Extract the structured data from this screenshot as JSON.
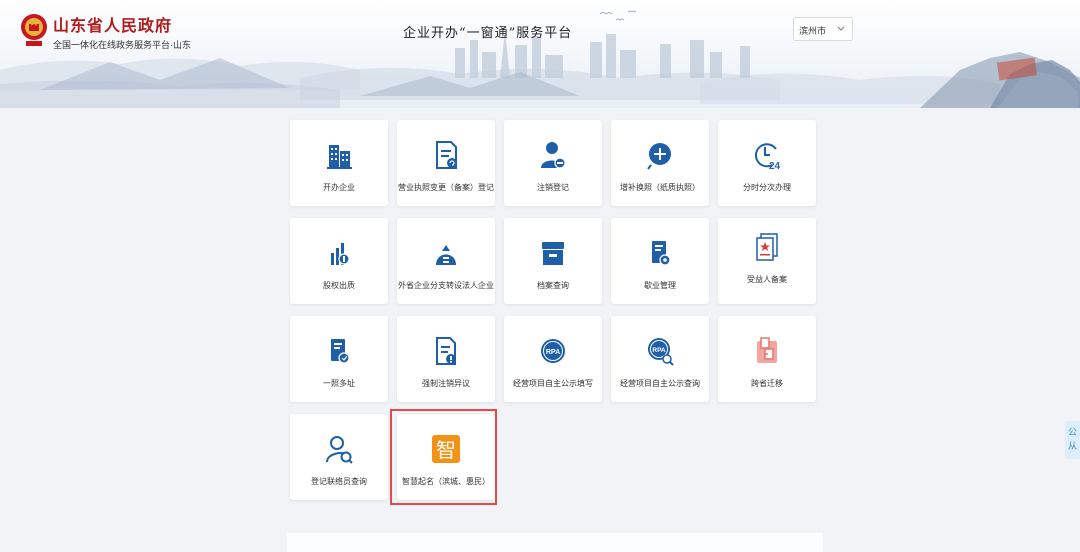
{
  "header": {
    "gov_title": "山东省人民政府",
    "gov_subtitle": "全国一体化在线政务服务平台·山东",
    "platform_title": "企业开办“一窗通”服务平台",
    "city_select": {
      "value": "滨州市"
    }
  },
  "services": [
    {
      "label": "开办企业",
      "icon": "buildings-icon"
    },
    {
      "label": "营业执照变更（备案）登记",
      "icon": "document-refresh-icon"
    },
    {
      "label": "注销登记",
      "icon": "user-remove-icon"
    },
    {
      "label": "增补换照（纸质执照）",
      "icon": "plus-circle-icon"
    },
    {
      "label": "分时分次办理",
      "icon": "clock-24-icon"
    },
    {
      "label": "股权出质",
      "icon": "equity-pledge-icon"
    },
    {
      "label": "外省企业分支转设法人企业",
      "icon": "branch-transfer-icon"
    },
    {
      "label": "档案查询",
      "icon": "archive-box-icon"
    },
    {
      "label": "歇业管理",
      "icon": "suspend-business-icon"
    },
    {
      "label": "受益人备案",
      "icon": "beneficiary-filing-icon"
    },
    {
      "label": "一照多址",
      "icon": "multi-address-icon"
    },
    {
      "label": "强制注销异议",
      "icon": "cancellation-objection-icon"
    },
    {
      "label": "经营项目自主公示填写",
      "icon": "rpa-fill-icon"
    },
    {
      "label": "经营项目自主公示查询",
      "icon": "rpa-search-icon"
    },
    {
      "label": "跨省迁移",
      "icon": "cross-province-migration-icon"
    },
    {
      "label": "登记联络员查询",
      "icon": "liaison-search-icon"
    },
    {
      "label": "智慧起名（滨城、惠民）",
      "icon": "smart-naming-icon"
    }
  ],
  "side_tab": {
    "line1": "公",
    "line2": "从"
  },
  "colors": {
    "icon_blue": "#1f5fa8",
    "accent_orange": "#f29318",
    "highlight_red": "#e34a4a",
    "gov_red": "#b31b1b"
  }
}
